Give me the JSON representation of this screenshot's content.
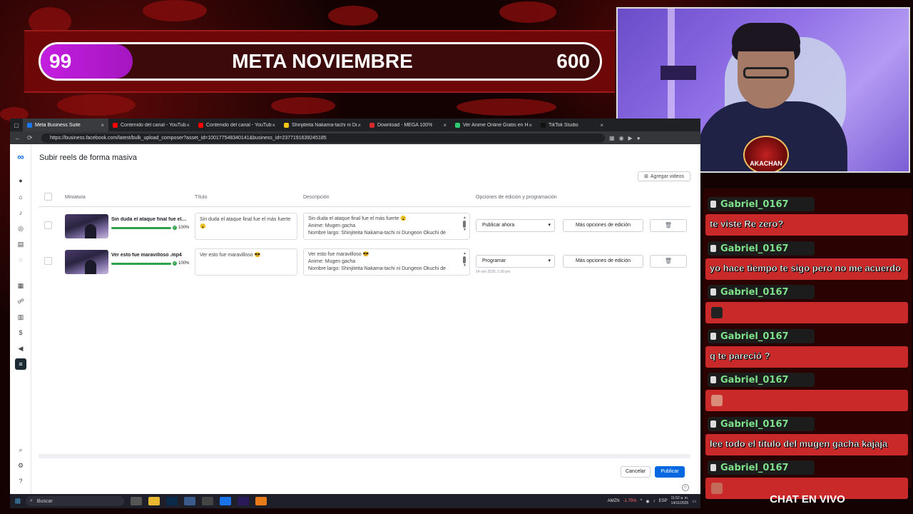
{
  "goal": {
    "current": "99",
    "title": "META NOVIEMBRE",
    "target": "600",
    "progress_fraction": 0.165
  },
  "webcam": {
    "badge_text": "AKACHAN"
  },
  "browser": {
    "tabs": [
      {
        "label": "Meta Business Suite",
        "color": "#1877f2",
        "active": true
      },
      {
        "label": "Contenido del canal - YouTube S",
        "color": "#ff0000",
        "active": false
      },
      {
        "label": "Contenido del canal - YouTube S",
        "color": "#ff0000",
        "active": false
      },
      {
        "label": "Shinjiteita Nakama-tachi ni Dung",
        "color": "#f5c518",
        "active": false
      },
      {
        "label": "Download - MEGA 100%",
        "color": "#d9272e",
        "active": false
      },
      {
        "label": "Ver Anime Online Gratis en HD y",
        "color": "#2ecc71",
        "active": false
      },
      {
        "label": "TikTok Studio",
        "color": "#111111",
        "active": false
      }
    ],
    "url": "https://business.facebook.com/latest/bulk_upload_composer?asset_id=100177548340141&business_id=2377191639245185"
  },
  "page": {
    "title": "Subir reels de forma masiva",
    "add_videos_label": "Agregar videos",
    "columns": {
      "thumbnail": "Miniatura",
      "title": "Título",
      "description": "Descripción",
      "options": "Opciones de edición y programación"
    },
    "rows": [
      {
        "file_name": "Sin duda el ataque final fue el ...",
        "progress": 1.0,
        "progress_label": "100%",
        "title_text": "Sin duda el ataque final fue el más fuerte 😮",
        "desc_lines": [
          "Sin duda el ataque final fue el más fuerte 😮",
          "Anime: Mugen gacha",
          "Nombre largo: Shinjiteita Nakama-tachi ni Dungeon Okuchi de"
        ],
        "schedule_option": "Publicar ahora",
        "schedule_date": "",
        "more_options_label": "Más opciones de edición"
      },
      {
        "file_name": "Ver esto fue maravilloso .mp4",
        "progress": 1.0,
        "progress_label": "100%",
        "title_text": "Ver esto fue maravilloso 😎",
        "desc_lines": [
          "Ver esto fue maravilloso 😎",
          "Anime: Mugen gacha",
          "Nombre largo: Shinjiteita Nakama-tachi ni Dungeon Okuchi de"
        ],
        "schedule_option": "Programar",
        "schedule_date": "14 nov 2025, 1:00 pm",
        "more_options_label": "Más opciones de edición"
      }
    ],
    "cancel_label": "Cancelar",
    "publish_label": "Publicar"
  },
  "chat": {
    "title": "CHAT EN VIVO",
    "messages": [
      {
        "user": "Gabriel_0167",
        "text": "te viste Re zero?"
      },
      {
        "user": "Gabriel_0167",
        "text": "yo hace tiempo te sigo pero no me acuerdo"
      },
      {
        "user": "Gabriel_0167",
        "text": "",
        "emote": "#222222"
      },
      {
        "user": "Gabriel_0167",
        "text": "q te pareció ?"
      },
      {
        "user": "Gabriel_0167",
        "text": "",
        "emote": "#d98c7a"
      },
      {
        "user": "Gabriel_0167",
        "text": "lee todo el título del mugen gacha kajaja"
      },
      {
        "user": "Gabriel_0167",
        "text": "",
        "emote": "#c46a5a"
      }
    ]
  },
  "taskbar": {
    "search_placeholder": "Buscar",
    "stock_symbol": "AMZN",
    "stock_change": "-1.75%",
    "language": "ESP",
    "time": "11:52 a. m.",
    "date": "14/11/2025"
  },
  "colors": {
    "brand": "#0668e1",
    "chat_bubble": "#c92929",
    "username": "#7ee08a",
    "goal_fill": "#c41ee0"
  }
}
